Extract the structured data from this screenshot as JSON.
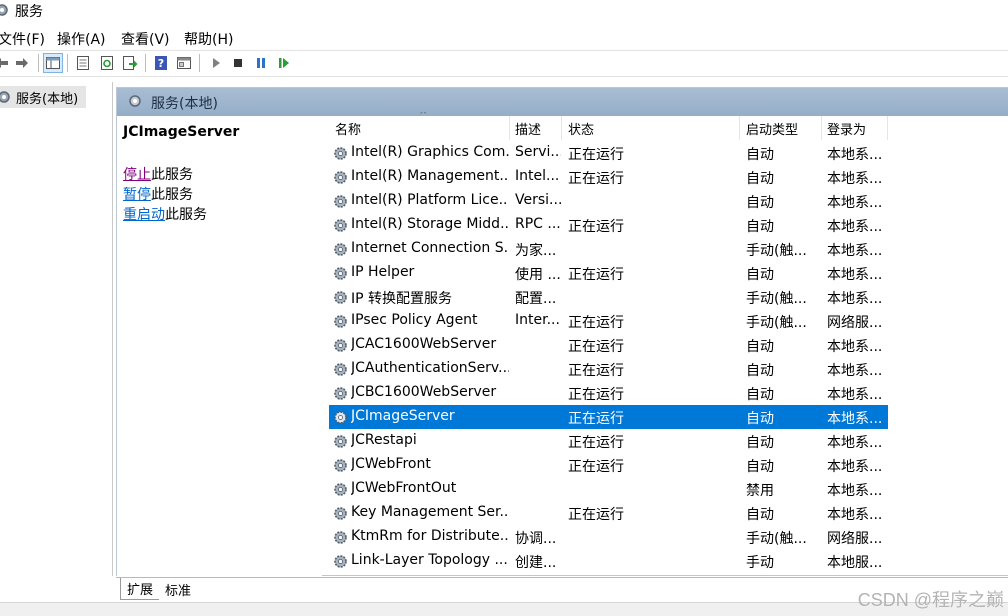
{
  "window": {
    "title": "服务"
  },
  "menu": {
    "items": [
      "文件(F)",
      "操作(A)",
      "查看(V)",
      "帮助(H)"
    ]
  },
  "toolbar": {
    "icons": [
      "back-icon",
      "forward-icon",
      "console-tree-icon",
      "properties-icon",
      "refresh-icon",
      "export-list-icon",
      "help-icon",
      "mmc-view-icon",
      "start-service-icon",
      "stop-service-icon",
      "pause-service-icon",
      "resume-service-icon"
    ]
  },
  "tree": {
    "root_label": "服务(本地)"
  },
  "panel": {
    "header_title": "服务(本地)",
    "selected_service": "JCImageServer",
    "actions": [
      {
        "link": "停止",
        "rest": "此服务"
      },
      {
        "link": "暂停",
        "rest": "此服务"
      },
      {
        "link": "重启动",
        "rest": "此服务"
      }
    ]
  },
  "table": {
    "columns": [
      "名称",
      "描述",
      "状态",
      "启动类型",
      "登录为"
    ],
    "sort_indicator": "^",
    "rows": [
      {
        "name": "Intel(R) Graphics Com...",
        "desc": "Servi...",
        "status": "正在运行",
        "startup": "自动",
        "logon": "本地系..."
      },
      {
        "name": "Intel(R) Management...",
        "desc": "Intel...",
        "status": "正在运行",
        "startup": "自动",
        "logon": "本地系..."
      },
      {
        "name": "Intel(R) Platform Lice...",
        "desc": "Versi...",
        "status": "",
        "startup": "自动",
        "logon": "本地系..."
      },
      {
        "name": "Intel(R) Storage Midd...",
        "desc": "RPC ...",
        "status": "正在运行",
        "startup": "自动",
        "logon": "本地系..."
      },
      {
        "name": "Internet Connection S...",
        "desc": "为家...",
        "status": "",
        "startup": "手动(触...",
        "logon": "本地系..."
      },
      {
        "name": "IP Helper",
        "desc": "使用 ...",
        "status": "正在运行",
        "startup": "自动",
        "logon": "本地系..."
      },
      {
        "name": "IP 转换配置服务",
        "desc": "配置...",
        "status": "",
        "startup": "手动(触...",
        "logon": "本地系..."
      },
      {
        "name": "IPsec Policy Agent",
        "desc": "Inter...",
        "status": "正在运行",
        "startup": "手动(触...",
        "logon": "网络服..."
      },
      {
        "name": "JCAC1600WebServer",
        "desc": "",
        "status": "正在运行",
        "startup": "自动",
        "logon": "本地系..."
      },
      {
        "name": "JCAuthenticationServ...",
        "desc": "",
        "status": "正在运行",
        "startup": "自动",
        "logon": "本地系..."
      },
      {
        "name": "JCBC1600WebServer",
        "desc": "",
        "status": "正在运行",
        "startup": "自动",
        "logon": "本地系..."
      },
      {
        "name": "JCImageServer",
        "desc": "",
        "status": "正在运行",
        "startup": "自动",
        "logon": "本地系...",
        "selected": true
      },
      {
        "name": "JCRestapi",
        "desc": "",
        "status": "正在运行",
        "startup": "自动",
        "logon": "本地系..."
      },
      {
        "name": "JCWebFront",
        "desc": "",
        "status": "正在运行",
        "startup": "自动",
        "logon": "本地系..."
      },
      {
        "name": "JCWebFrontOut",
        "desc": "",
        "status": "",
        "startup": "禁用",
        "logon": "本地系..."
      },
      {
        "name": "Key Management Ser...",
        "desc": "",
        "status": "正在运行",
        "startup": "自动",
        "logon": "本地系..."
      },
      {
        "name": "KtmRm for Distribute...",
        "desc": "协调...",
        "status": "",
        "startup": "手动(触...",
        "logon": "网络服..."
      },
      {
        "name": "Link-Layer Topology ...",
        "desc": "创建...",
        "status": "",
        "startup": "手动",
        "logon": "本地服..."
      }
    ]
  },
  "tabs": [
    "扩展",
    "标准"
  ],
  "watermark": "CSDN @程序之巅"
}
